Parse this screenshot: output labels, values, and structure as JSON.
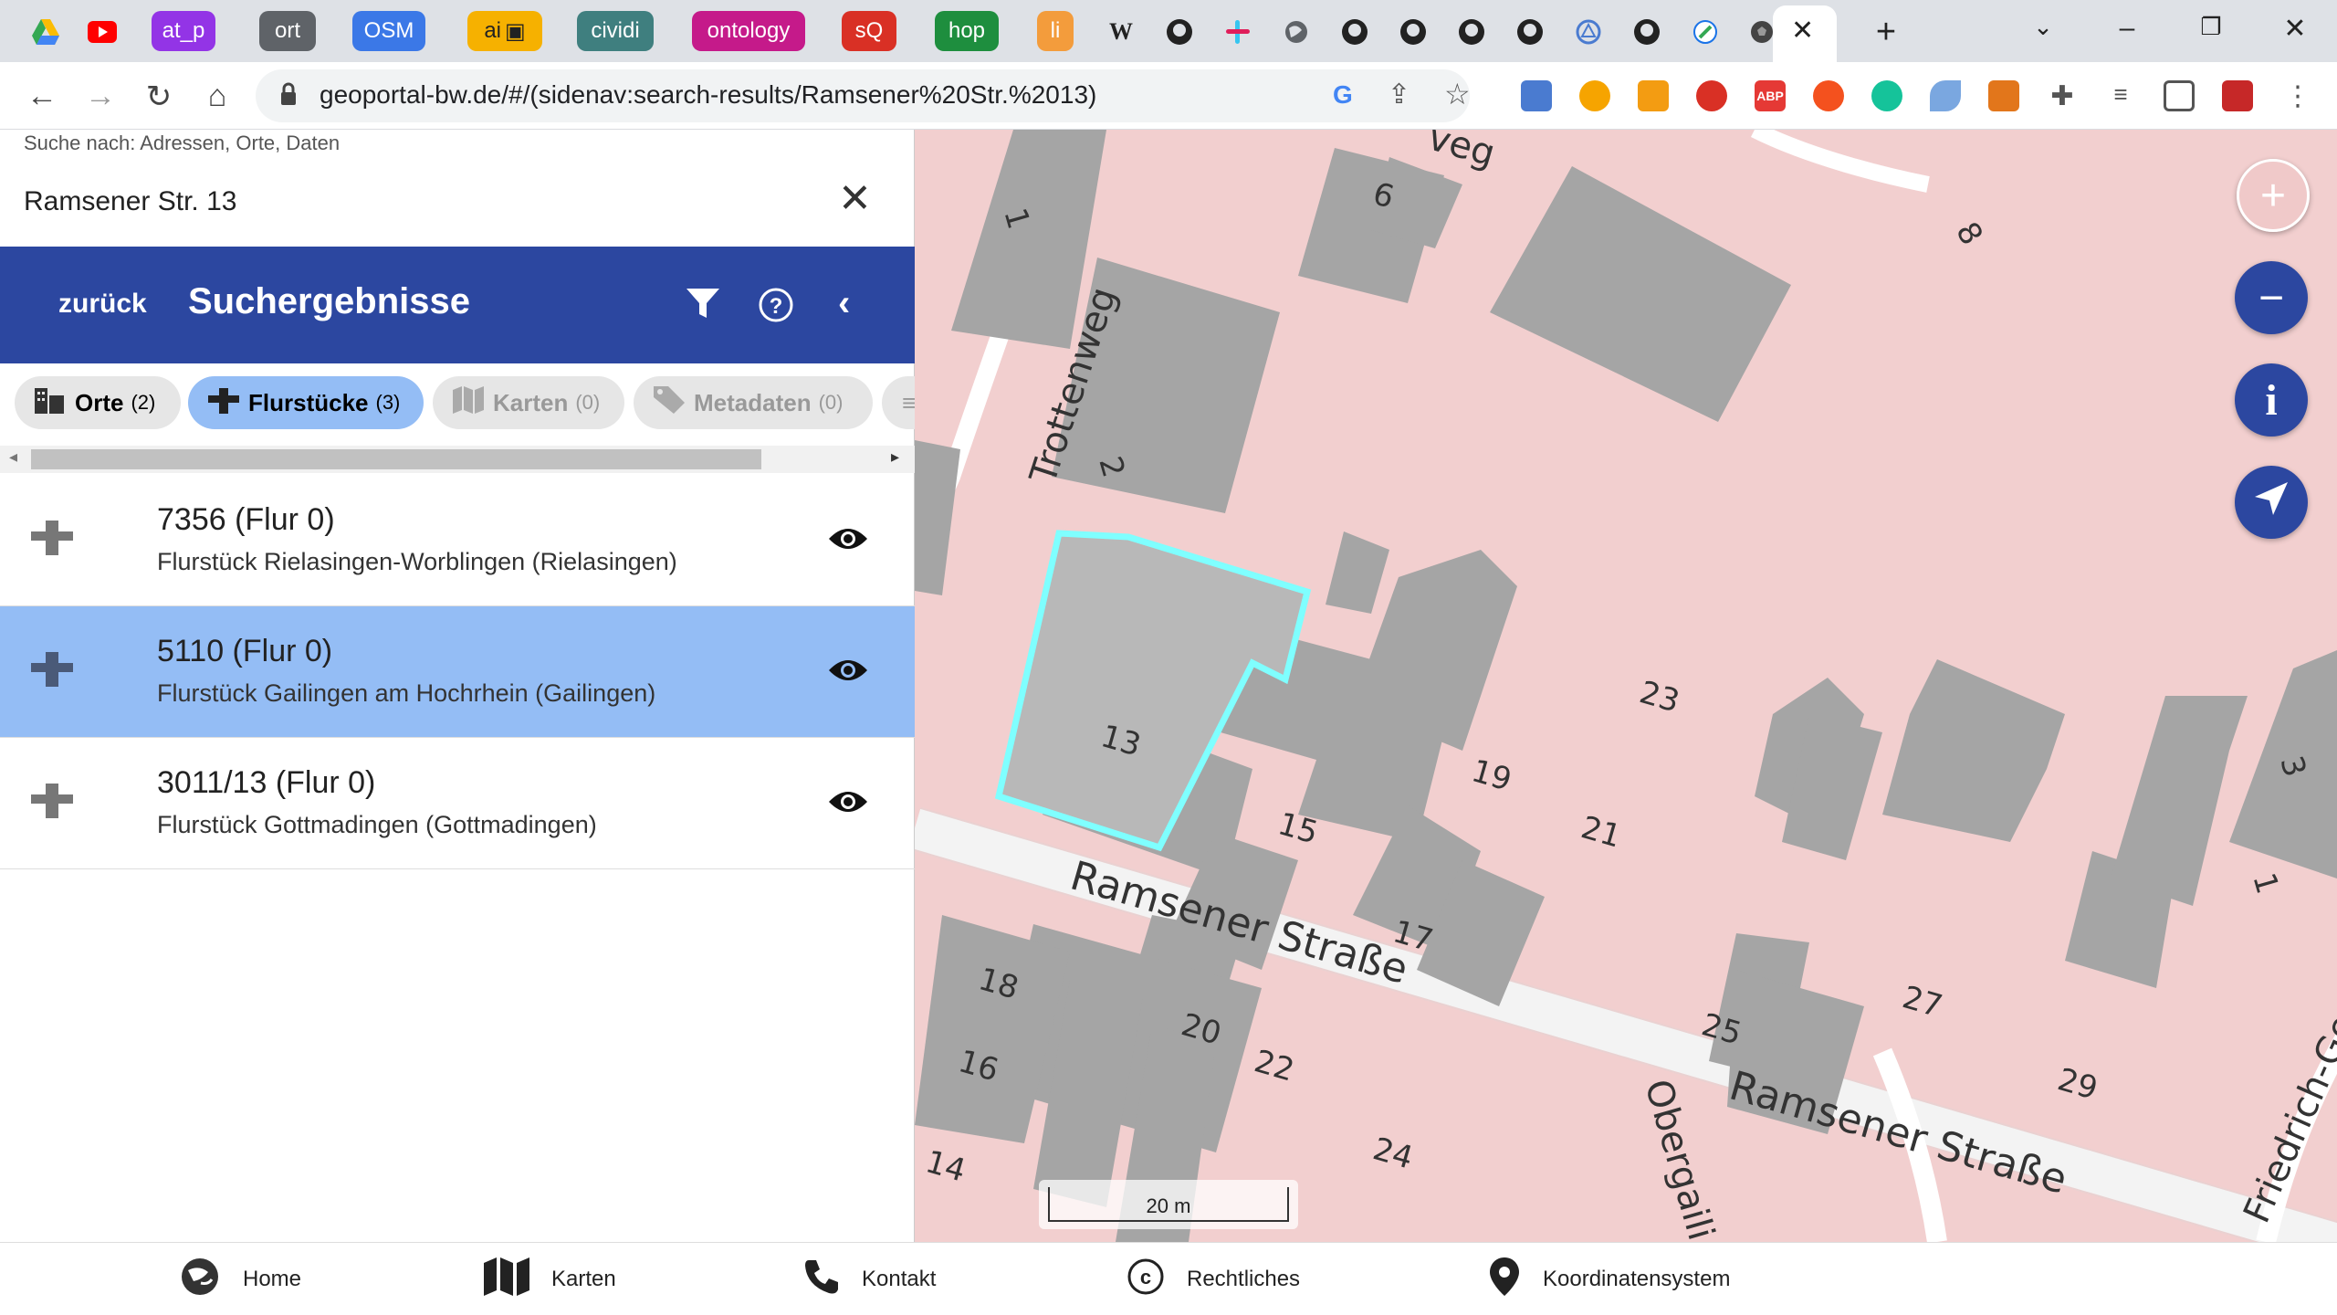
{
  "browser": {
    "tabs": [
      {
        "label": "at_p",
        "color": "#9334e6"
      },
      {
        "label": "ort",
        "color": "#5f6368"
      },
      {
        "label": "OSM",
        "color": "#3b78e7"
      },
      {
        "label": "ai",
        "color": "#f6b100"
      },
      {
        "label": "cividi",
        "color": "#3f7f7f"
      },
      {
        "label": "ontology",
        "color": "#c51a8a"
      },
      {
        "label": "sQ",
        "color": "#d93025"
      },
      {
        "label": "hop",
        "color": "#1e8e3e"
      },
      {
        "label": "li",
        "color": "#f39c3c"
      }
    ],
    "url": "geoportal-bw.de/#/(sidenav:search-results/Ramsener%20Str.%2013)"
  },
  "search": {
    "placeholder": "Suche nach: Adressen, Orte, Daten",
    "value": "Ramsener Str. 13"
  },
  "header": {
    "back_label": "zurück",
    "title": "Suchergebnisse"
  },
  "chips": [
    {
      "label": "Orte",
      "count": "(2)"
    },
    {
      "label": "Flurstücke",
      "count": "(3)"
    },
    {
      "label": "Karten",
      "count": "(0)"
    },
    {
      "label": "Metadaten",
      "count": "(0)"
    }
  ],
  "results": [
    {
      "title": "7356 (Flur 0)",
      "subtitle": "Flurstück Rielasingen-Worblingen (Rielasingen)"
    },
    {
      "title": "5110 (Flur 0)",
      "subtitle": "Flurstück Gailingen am Hochrhein (Gailingen)"
    },
    {
      "title": "3011/13 (Flur 0)",
      "subtitle": "Flurstück Gottmadingen (Gottmadingen)"
    }
  ],
  "map": {
    "street_trottenweg": "Trottenweg",
    "street_ramsener_1": "Ramsener Straße",
    "street_ramsener_2": "Ramsener Straße",
    "street_obergaili": "Obergaili",
    "street_friedrich": "Friedrich-Georg-Sch",
    "street_weg": "veg",
    "house_numbers": [
      "6",
      "8",
      "1",
      "2",
      "13",
      "15",
      "17",
      "19",
      "21",
      "23",
      "25",
      "27",
      "29",
      "3",
      "1",
      "18",
      "16",
      "14",
      "20",
      "22",
      "24"
    ],
    "scale_label": "20 m",
    "highlight_color": "#7fffff"
  },
  "bottom_nav": {
    "home": "Home",
    "karten": "Karten",
    "kontakt": "Kontakt",
    "rechtliches": "Rechtliches",
    "koordinatensystem": "Koordinatensystem"
  }
}
